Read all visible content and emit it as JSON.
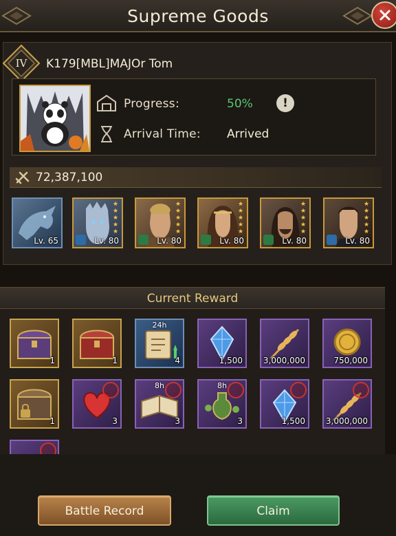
{
  "window": {
    "title": "Supreme Goods",
    "close_icon": "close-icon"
  },
  "player": {
    "rank": "IV",
    "name": "K179[MBL]MAJOr Tom",
    "progress_label": "Progress:",
    "progress_value": "50%",
    "arrival_label": "Arrival Time:",
    "arrival_value": "Arrived",
    "power": "72,387,100"
  },
  "heroes": [
    {
      "level": "Lv. 65",
      "stars": 0,
      "name": "dragon"
    },
    {
      "level": "Lv. 80",
      "stars": 5,
      "name": "night-king"
    },
    {
      "level": "Lv. 80",
      "stars": 5,
      "name": "knight"
    },
    {
      "level": "Lv. 80",
      "stars": 5,
      "name": "lady"
    },
    {
      "level": "Lv. 80",
      "stars": 5,
      "name": "warrior"
    },
    {
      "level": "Lv. 80",
      "stars": 5,
      "name": "lord"
    }
  ],
  "reward": {
    "title": "Current Reward",
    "items": [
      {
        "icon": "purple-chest-icon",
        "count": "1",
        "timer": "",
        "style": "gold"
      },
      {
        "icon": "red-chest-icon",
        "count": "1",
        "timer": "",
        "style": "gold"
      },
      {
        "icon": "scroll-icon",
        "count": "4",
        "timer": "24h",
        "style": "blue"
      },
      {
        "icon": "blue-crystal-icon",
        "count": "1,500",
        "timer": "",
        "style": "purple"
      },
      {
        "icon": "wheat-icon",
        "count": "3,000,000",
        "timer": "",
        "style": "purple"
      },
      {
        "icon": "gold-coin-icon",
        "count": "750,000",
        "timer": "",
        "style": "purple"
      },
      {
        "icon": "locked-chest-icon",
        "count": "1",
        "timer": "",
        "style": "gold"
      },
      {
        "icon": "heart-icon",
        "count": "3",
        "timer": "",
        "style": "purple"
      },
      {
        "icon": "book-icon",
        "count": "3",
        "timer": "8h",
        "style": "purple"
      },
      {
        "icon": "potion-icon",
        "count": "3",
        "timer": "8h",
        "style": "purple"
      },
      {
        "icon": "blue-crystal-icon",
        "count": "1,500",
        "timer": "",
        "style": "purple"
      },
      {
        "icon": "wheat-icon",
        "count": "3,000,000",
        "timer": "",
        "style": "purple"
      },
      {
        "icon": "partial-item-icon",
        "count": "",
        "timer": "",
        "style": "purple"
      }
    ]
  },
  "buttons": {
    "battle_record": "Battle Record",
    "claim": "Claim"
  },
  "colors": {
    "progress_green": "#57c774",
    "gold_border": "#c9a44c",
    "purple_border": "#8a62b6",
    "header_text": "#e5c981"
  }
}
